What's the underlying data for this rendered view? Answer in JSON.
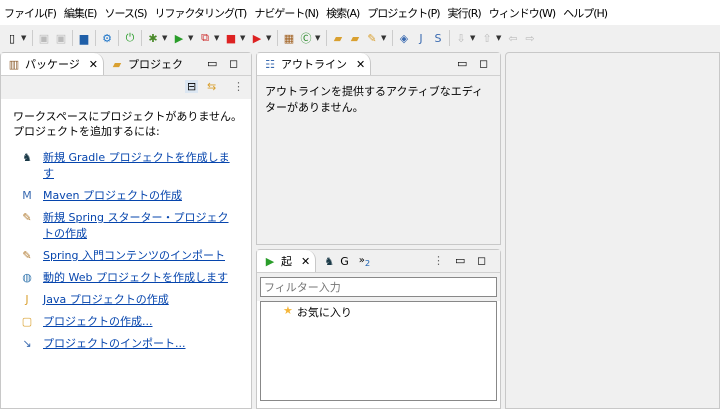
{
  "menu": [
    "ファイル(F)",
    "編集(E)",
    "ソース(S)",
    "リファクタリング(T)",
    "ナビゲート(N)",
    "検索(A)",
    "プロジェクト(P)",
    "実行(R)",
    "ウィンドウ(W)",
    "ヘルプ(H)"
  ],
  "left_panel": {
    "tabs": [
      {
        "label": "パッケージ"
      },
      {
        "label": "プロジェク"
      }
    ],
    "message_line1": "ワークスペースにプロジェクトがありません。",
    "message_line2": "プロジェクトを追加するには:",
    "links": [
      {
        "label": "新規 Gradle プロジェクトを作成します",
        "icon": "gradle-icon"
      },
      {
        "label": "Maven プロジェクトの作成",
        "icon": "maven-icon"
      },
      {
        "label": "新規 Spring スターター・プロジェクトの作成",
        "icon": "spring-icon"
      },
      {
        "label": "Spring 入門コンテンツのインポート",
        "icon": "spring-icon"
      },
      {
        "label": "動的 Web プロジェクトを作成します",
        "icon": "web-icon"
      },
      {
        "label": "Java プロジェクトの作成",
        "icon": "java-project-icon"
      },
      {
        "label": "プロジェクトの作成...",
        "icon": "new-project-icon"
      },
      {
        "label": "プロジェクトのインポート...",
        "icon": "import-icon"
      }
    ]
  },
  "outline": {
    "tab": "アウトライン",
    "message": "アウトラインを提供するアクティブなエディターがありません。"
  },
  "bottom_panel": {
    "tabs": [
      {
        "label": "起"
      },
      {
        "label": "G"
      },
      {
        "label": "2"
      }
    ],
    "filter_placeholder": "フィルター入力",
    "tree_item": "お気に入り"
  }
}
